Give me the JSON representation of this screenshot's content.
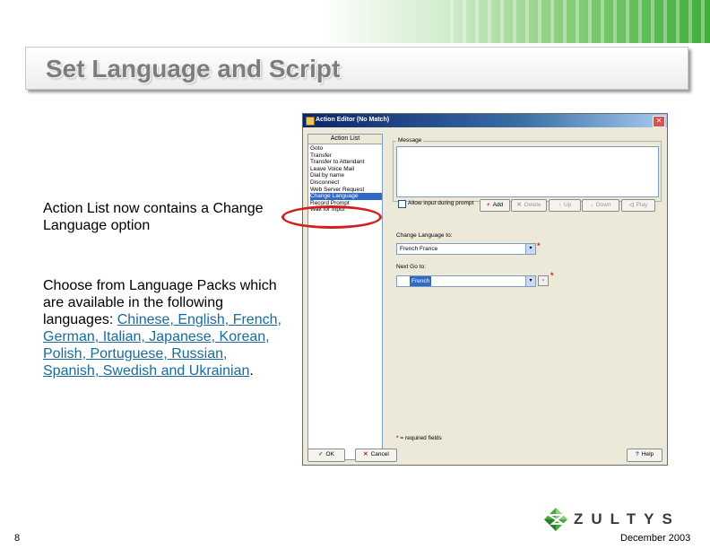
{
  "slide": {
    "title": "Set Language and Script",
    "para1": "Action List now contains a Change Language option",
    "para2_intro": "Choose from Language Packs which are available in the following languages: ",
    "para2_languages": "Chinese, English, French, German, Italian, Japanese, Korean, Polish, Portuguese, Russian, Spanish, Swedish and Ukrainian",
    "para2_end": ".",
    "page_number": "8",
    "date": "December 2003",
    "logo_text": "ZULTYS"
  },
  "dialog": {
    "title": "Action Editor (No Match)",
    "close_glyph": "✕",
    "action_list_header": "Action List",
    "action_items": [
      "Goto",
      "Transfer",
      "Transfer to Attendant",
      "Leave Voice Mail",
      "Dial by name",
      "Disconnect",
      "Web Server Request",
      "Change Language",
      "Record Prompt",
      "Wait for Input"
    ],
    "selected_index": 7,
    "message_label": "Message",
    "allow_input_label": "Allow input during prompt",
    "buttons": {
      "add": "Add",
      "add_icon": "+",
      "delete": "Delete",
      "delete_icon": "✕",
      "up": "Up",
      "up_icon": "↑",
      "down": "Down",
      "down_icon": "↓",
      "play": "Play",
      "play_icon": "◁",
      "ok": "OK",
      "ok_icon": "✓",
      "cancel": "Cancel",
      "cancel_icon": "✕",
      "help": "Help",
      "help_icon": "?"
    },
    "change_language_label": "Change Language to:",
    "change_language_value": "French France",
    "next_goto_label": "Next Go to:",
    "next_goto_value": "French",
    "required_marker": "*",
    "required_note": "= required fields",
    "combo_arrow": "▾",
    "small_button_glyph": "▫"
  },
  "colors": {
    "title_grey": "#7d7d7d",
    "link_teal": "#1a6b9a",
    "highlight_red": "#d22020",
    "brand_green": "#3fae3a",
    "selection_blue": "#316ac5"
  }
}
